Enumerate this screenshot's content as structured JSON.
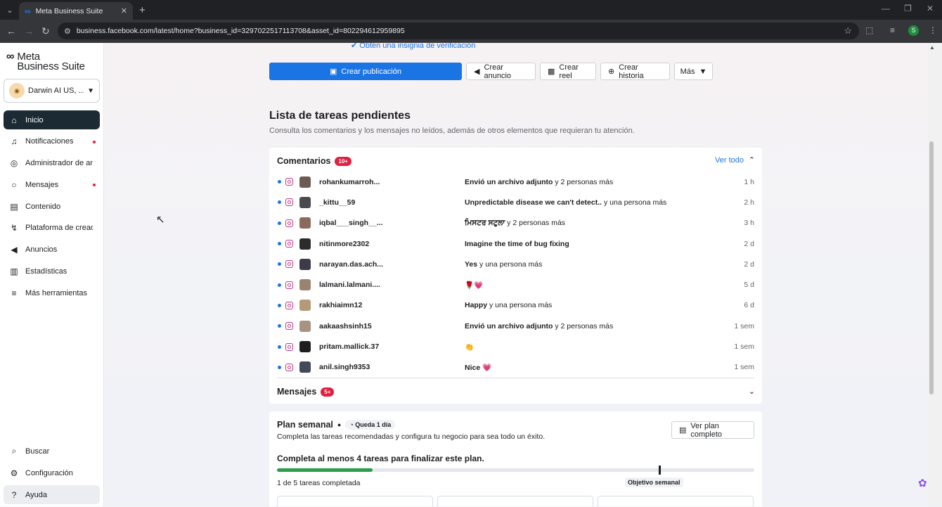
{
  "browser": {
    "tab_title": "Meta Business Suite",
    "url": "business.facebook.com/latest/home?business_id=3297022517113708&asset_id=802294612959895",
    "profile_initial": "S"
  },
  "sidebar": {
    "logo_line1": "Meta",
    "logo_line2": "Business Suite",
    "account": "Darwin AI US, ...",
    "items": [
      {
        "label": "Inicio"
      },
      {
        "label": "Notificaciones"
      },
      {
        "label": "Administrador de anuncios"
      },
      {
        "label": "Mensajes"
      },
      {
        "label": "Contenido"
      },
      {
        "label": "Plataforma de creadores"
      },
      {
        "label": "Anuncios"
      },
      {
        "label": "Estadísticas"
      },
      {
        "label": "Más herramientas"
      }
    ],
    "bottom": [
      {
        "label": "Buscar"
      },
      {
        "label": "Configuración"
      },
      {
        "label": "Ayuda"
      }
    ]
  },
  "main": {
    "verify_link": "Obtén una insignia de verificación",
    "actions": {
      "create_post": "Crear publicación",
      "create_ad": "Crear anuncio",
      "create_reel": "Crear reel",
      "create_story": "Crear historia",
      "more": "Más"
    },
    "todo_title": "Lista de tareas pendientes",
    "todo_subtitle": "Consulta los comentarios y los mensajes no leídos, además de otros elementos que requieran tu atención.",
    "comments": {
      "title": "Comentarios",
      "badge": "10+",
      "see_all": "Ver todo",
      "rows": [
        {
          "user": "rohankumarroh...",
          "msg_bold": "Envió un archivo adjunto",
          "msg_rest": " y 2 personas más",
          "time": "1 h",
          "avatar_color": "#6b5b52"
        },
        {
          "user": "_kittu__59",
          "msg_bold": "Unpredictable disease we can't detect..",
          "msg_rest": " y una persona más",
          "time": "2 h",
          "avatar_color": "#4a4a50"
        },
        {
          "user": "iqbal___singh__...",
          "msg_bold": "ਮਿਸਟਰ ਸਟੁਲਾ",
          "msg_rest": " y 2 personas más",
          "time": "3 h",
          "avatar_color": "#8a6a5a"
        },
        {
          "user": "nitinmore2302",
          "msg_bold": "Imagine the time of bug fixing",
          "msg_rest": "",
          "time": "2 d",
          "avatar_color": "#2c2c2c"
        },
        {
          "user": "narayan.das.ach...",
          "msg_bold": "Yes",
          "msg_rest": " y una persona más",
          "time": "2 d",
          "avatar_color": "#3e3a4a"
        },
        {
          "user": "lalmani.lalmani....",
          "msg_bold": "🌹💗",
          "msg_rest": "",
          "time": "5 d",
          "avatar_color": "#9a8470"
        },
        {
          "user": "rakhiaimn12",
          "msg_bold": "Happy",
          "msg_rest": " y una persona más",
          "time": "6 d",
          "avatar_color": "#b59a7a"
        },
        {
          "user": "aakaashsinh15",
          "msg_bold": "Envió un archivo adjunto",
          "msg_rest": " y 2 personas más",
          "time": "1 sem",
          "avatar_color": "#a89280"
        },
        {
          "user": "pritam.mallick.37",
          "msg_bold": "👏",
          "msg_rest": "",
          "time": "1 sem",
          "avatar_color": "#1e1e1e"
        },
        {
          "user": "anil.singh9353",
          "msg_bold": "Nice 💗",
          "msg_rest": "",
          "time": "1 sem",
          "avatar_color": "#44485a"
        }
      ]
    },
    "messages": {
      "title": "Mensajes",
      "badge": "5+"
    },
    "plan": {
      "title": "Plan semanal",
      "chip": "Queda 1 día",
      "subtitle": "Completa las tareas recomendadas y configura tu negocio para sea todo un éxito.",
      "button": "Ver plan completo",
      "goal": "Completa al menos 4 tareas para finalizar este plan.",
      "progress_fraction": 0.2,
      "weekly_goal_fraction": 0.8,
      "weekly_tag": "Objetivo semanal",
      "count": "1 de 5 tareas completada"
    }
  }
}
